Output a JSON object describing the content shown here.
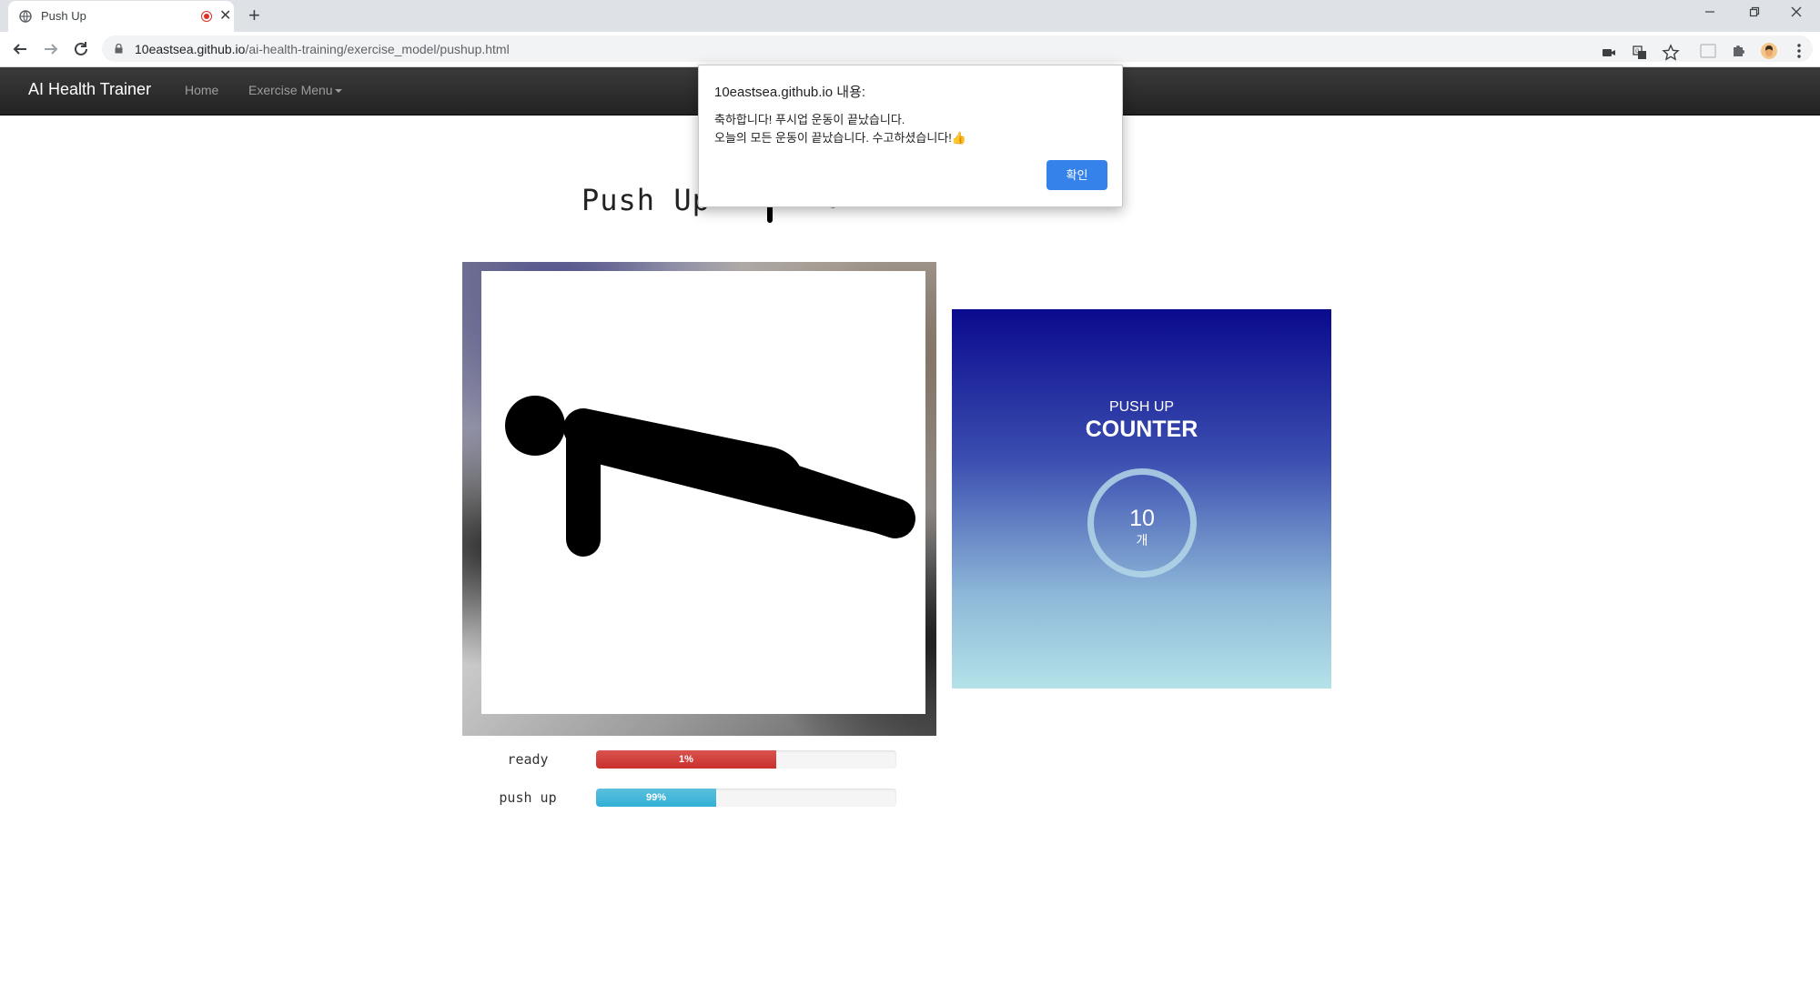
{
  "browser": {
    "tab_title": "Push Up",
    "url_host": "10eastsea.github.io",
    "url_path": "/ai-health-training/exercise_model/pushup.html",
    "new_tab_symbol": "+",
    "tab_close_symbol": "✕"
  },
  "navbar": {
    "brand": "AI Health Trainer",
    "links": [
      "Home",
      "Exercise Menu"
    ]
  },
  "main": {
    "title": "Push Up"
  },
  "predictions": [
    {
      "label": "ready",
      "percent_text": "1%",
      "fill_fraction": 0.6,
      "color": "#d9534f"
    },
    {
      "label": "push up",
      "percent_text": "99%",
      "fill_fraction": 0.4,
      "color": "#5bc0de"
    }
  ],
  "counter": {
    "subtitle": "PUSH UP",
    "title": "COUNTER",
    "count": "10",
    "unit": "개"
  },
  "dialog": {
    "title": "10eastsea.github.io 내용:",
    "line1": "축하합니다! 푸시업 운동이 끝났습니다.",
    "line2": "오늘의 모든 운동이 끝났습니다. 수고하셨습니다!👍",
    "ok_label": "확인",
    "ok_color": "#1a73e8"
  },
  "icons": [
    "globe-icon",
    "recording-icon",
    "close-icon",
    "new-tab-icon",
    "back-icon",
    "forward-icon",
    "reload-icon",
    "lock-icon",
    "camera-icon",
    "translate-icon",
    "star-icon",
    "extension-icon",
    "puzzle-icon",
    "profile-avatar",
    "menu-dots-icon",
    "minimize-icon",
    "restore-icon",
    "window-close-icon"
  ]
}
